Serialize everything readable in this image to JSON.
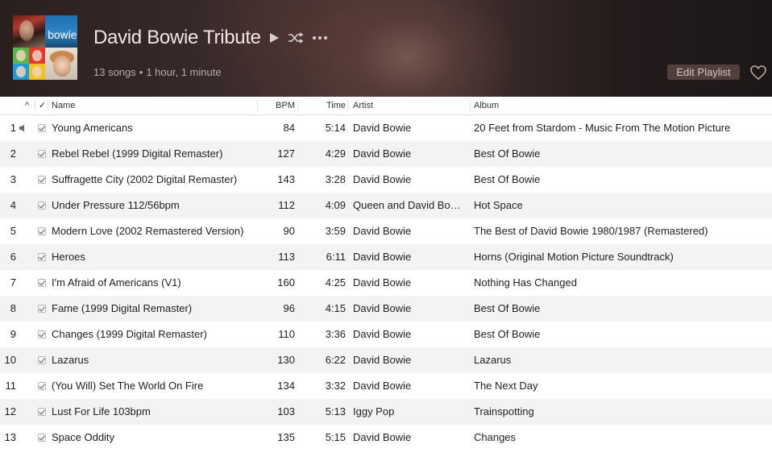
{
  "playlist": {
    "title": "David Bowie Tribute",
    "song_count": "13 songs",
    "duration": "1 hour, 1 minute",
    "separator": "•",
    "artwork_labels": {
      "tile2": "bowie"
    },
    "edit_label": "Edit Playlist",
    "actions": [
      "play-icon",
      "shuffle-icon",
      "more-icon"
    ]
  },
  "columns": {
    "sort_indicator": "^",
    "check": "✓",
    "name": "Name",
    "bpm": "BPM",
    "time": "Time",
    "artist": "Artist",
    "album": "Album"
  },
  "tracks": [
    {
      "num": "1",
      "name": "Young Americans",
      "bpm": "84",
      "time": "5:14",
      "artist": "David Bowie",
      "album": "20 Feet from Stardom - Music From The Motion Picture",
      "playing": true
    },
    {
      "num": "2",
      "name": "Rebel Rebel (1999 Digital Remaster)",
      "bpm": "127",
      "time": "4:29",
      "artist": "David Bowie",
      "album": "Best Of Bowie"
    },
    {
      "num": "3",
      "name": "Suffragette City (2002 Digital Remaster)",
      "bpm": "143",
      "time": "3:28",
      "artist": "David Bowie",
      "album": "Best Of Bowie"
    },
    {
      "num": "4",
      "name": "Under Pressure 112/56bpm",
      "bpm": "112",
      "time": "4:09",
      "artist": "Queen and David Bo…",
      "album": "Hot Space"
    },
    {
      "num": "5",
      "name": "Modern Love (2002 Remastered Version)",
      "bpm": "90",
      "time": "3:59",
      "artist": "David Bowie",
      "album": "The Best of David Bowie 1980/1987 (Remastered)"
    },
    {
      "num": "6",
      "name": "Heroes",
      "bpm": "113",
      "time": "6:11",
      "artist": "David Bowie",
      "album": "Horns (Original Motion Picture Soundtrack)"
    },
    {
      "num": "7",
      "name": "I'm Afraid of Americans (V1)",
      "bpm": "160",
      "time": "4:25",
      "artist": "David Bowie",
      "album": "Nothing Has Changed"
    },
    {
      "num": "8",
      "name": "Fame (1999 Digital Remaster)",
      "bpm": "96",
      "time": "4:15",
      "artist": "David Bowie",
      "album": "Best Of Bowie"
    },
    {
      "num": "9",
      "name": "Changes (1999 Digital Remaster)",
      "bpm": "110",
      "time": "3:36",
      "artist": "David Bowie",
      "album": "Best Of Bowie"
    },
    {
      "num": "10",
      "name": "Lazarus",
      "bpm": "130",
      "time": "6:22",
      "artist": "David Bowie",
      "album": "Lazarus"
    },
    {
      "num": "11",
      "name": "(You Will) Set The World On Fire",
      "bpm": "134",
      "time": "3:32",
      "artist": "David Bowie",
      "album": "The Next Day"
    },
    {
      "num": "12",
      "name": "Lust For Life 103bpm",
      "bpm": "103",
      "time": "5:13",
      "artist": "Iggy Pop",
      "album": "Trainspotting"
    },
    {
      "num": "13",
      "name": "Space Oddity",
      "bpm": "135",
      "time": "5:15",
      "artist": "David Bowie",
      "album": "Changes"
    }
  ]
}
